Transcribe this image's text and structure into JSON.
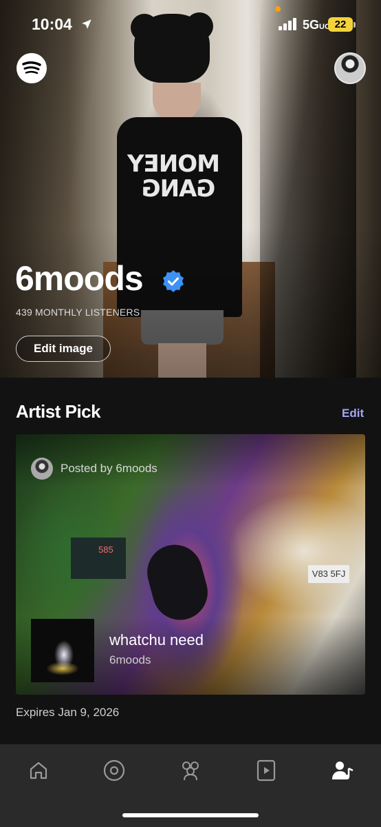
{
  "status_bar": {
    "time": "10:04",
    "location_arrow": "location-arrow-icon",
    "network": "5G",
    "network_suffix": "UC",
    "battery": "22"
  },
  "header": {
    "logo_icon": "spotify-logo-icon",
    "artist_name": "6moods",
    "monthly_listeners": "439 MONTHLY LISTENERS",
    "edit_image_label": "Edit image"
  },
  "artist_pick": {
    "title": "Artist Pick",
    "edit_label": "Edit",
    "posted_by": "Posted by 6moods",
    "track_title": "whatchu need",
    "track_artist": "6moods",
    "expires": "Expires Jan 9, 2026"
  },
  "hero_shirt_text": "MONEY GANG",
  "nav": {
    "items": [
      "home-icon",
      "releases-icon",
      "audience-icon",
      "music-icon",
      "profile-icon"
    ]
  },
  "colors": {
    "accent_edit": "#a3a6f7",
    "battery": "#f4d23c",
    "verified": "#3d91f4",
    "background": "#121212",
    "nav_background": "#2a2a2a"
  }
}
